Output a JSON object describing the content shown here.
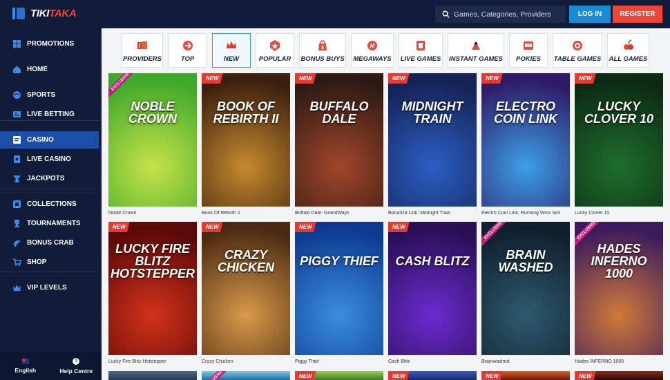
{
  "brand": {
    "name_a": "TIKI",
    "name_b": "TAKA"
  },
  "header": {
    "search_placeholder": "Games, Categories, Providers",
    "login_label": "LOG IN",
    "register_label": "REGISTER"
  },
  "sidebar": {
    "items": [
      {
        "label": "PROMOTIONS",
        "icon": "promotions-icon"
      },
      {
        "label": "HOME",
        "icon": "home-icon"
      },
      {
        "label": "SPORTS",
        "icon": "sports-icon"
      },
      {
        "label": "LIVE BETTING",
        "icon": "live-betting-icon"
      },
      {
        "label": "CASINO",
        "icon": "casino-icon",
        "active": true
      },
      {
        "label": "LIVE CASINO",
        "icon": "live-casino-icon"
      },
      {
        "label": "JACKPOTS",
        "icon": "jackpots-icon"
      },
      {
        "label": "COLLECTIONS",
        "icon": "collections-icon"
      },
      {
        "label": "TOURNAMENTS",
        "icon": "tournaments-icon"
      },
      {
        "label": "BONUS CRAB",
        "icon": "bonus-crab-icon"
      },
      {
        "label": "SHOP",
        "icon": "shop-icon"
      },
      {
        "label": "VIP LEVELS",
        "icon": "vip-icon"
      }
    ],
    "footer": {
      "language_label": "English",
      "help_label": "Help Centre"
    }
  },
  "tabs": [
    {
      "label": "PROVIDERS",
      "icon": "providers-icon"
    },
    {
      "label": "TOP",
      "icon": "top-icon"
    },
    {
      "label": "NEW",
      "icon": "new-icon",
      "active": true
    },
    {
      "label": "POPULAR",
      "icon": "popular-icon"
    },
    {
      "label": "BONUS BUYS",
      "icon": "bonus-buys-icon"
    },
    {
      "label": "MEGAWAYS",
      "icon": "megaways-icon"
    },
    {
      "label": "LIVE GAMES",
      "icon": "live-games-icon"
    },
    {
      "label": "INSTANT GAMES",
      "icon": "instant-games-icon"
    },
    {
      "label": "POKIES",
      "icon": "pokies-icon"
    },
    {
      "label": "TABLE GAMES",
      "icon": "table-games-icon"
    },
    {
      "label": "ALL GAMES",
      "icon": "all-games-icon"
    }
  ],
  "games": [
    {
      "name": "Noble Crown",
      "art_title": "NOBLE CROWN",
      "badge": "EXCLUSIVE",
      "colors": [
        "#3fa82a",
        "#c7e34a"
      ]
    },
    {
      "name": "Book Of Rebirth 2",
      "art_title": "BOOK OF REBIRTH II",
      "badge": "NEW",
      "colors": [
        "#3a1f0e",
        "#c78a2e"
      ]
    },
    {
      "name": "Buffalo Dale: GrandWays",
      "art_title": "BUFFALO DALE",
      "badge": "NEW",
      "colors": [
        "#2d1a14",
        "#a2462a"
      ]
    },
    {
      "name": "Bonanza Link: Midnight Train",
      "art_title": "MIDNIGHT TRAIN",
      "badge": "NEW",
      "colors": [
        "#152255",
        "#2b5fc4"
      ]
    },
    {
      "name": "Electro Coin Link: Running Wins 3x3",
      "art_title": "ELECTRO COIN LINK",
      "badge": "NEW",
      "colors": [
        "#2e1a66",
        "#3ca0e8"
      ]
    },
    {
      "name": "Lucky Clover 10",
      "art_title": "LUCKY CLOVER 10",
      "badge": "NEW",
      "colors": [
        "#0c2a14",
        "#1f6e2c"
      ]
    },
    {
      "name": "Lucky Fire Blitz Hotstepper",
      "art_title": "LUCKY FIRE BLITZ HOTSTEPPER",
      "badge": "NEW",
      "colors": [
        "#5a0808",
        "#d2321a"
      ]
    },
    {
      "name": "Crazy Chicken",
      "art_title": "CRAZY CHICKEN",
      "badge": "NEW",
      "colors": [
        "#4a2a12",
        "#d99a4a"
      ]
    },
    {
      "name": "Piggy Thief",
      "art_title": "PIGGY THIEF",
      "badge": "NEW",
      "colors": [
        "#0d3a8e",
        "#3a8de0"
      ]
    },
    {
      "name": "Cash Blitz",
      "art_title": "CASH BLITZ",
      "badge": "NEW",
      "colors": [
        "#2a0f55",
        "#6b2bd0"
      ]
    },
    {
      "name": "Brainwashed",
      "art_title": "BRAIN WASHED",
      "badge": "EXCLUSIVE",
      "colors": [
        "#0f1f2e",
        "#2f5a6e"
      ]
    },
    {
      "name": "Hades INFERNO 1000",
      "art_title": "HADES INFERNO 1000",
      "badge": "EXCLUSIVE",
      "colors": [
        "#3b1a5e",
        "#d07a3a"
      ]
    }
  ],
  "peek_row": [
    {
      "badge": "",
      "colors": [
        "#2a3a4e",
        "#4a6a8a"
      ]
    },
    {
      "badge": "EXCLUSIVE",
      "colors": [
        "#1f6e9e",
        "#7ec8e8"
      ]
    },
    {
      "badge": "NEW",
      "colors": [
        "#3a7a2a",
        "#9ed04a"
      ]
    },
    {
      "badge": "NEW",
      "colors": [
        "#1a2a6a",
        "#3a5ac0"
      ]
    },
    {
      "badge": "NEW",
      "colors": [
        "#6a1a0a",
        "#e0602a"
      ]
    },
    {
      "badge": "NEW",
      "colors": [
        "#2a0a0a",
        "#8a2a1a"
      ]
    }
  ]
}
